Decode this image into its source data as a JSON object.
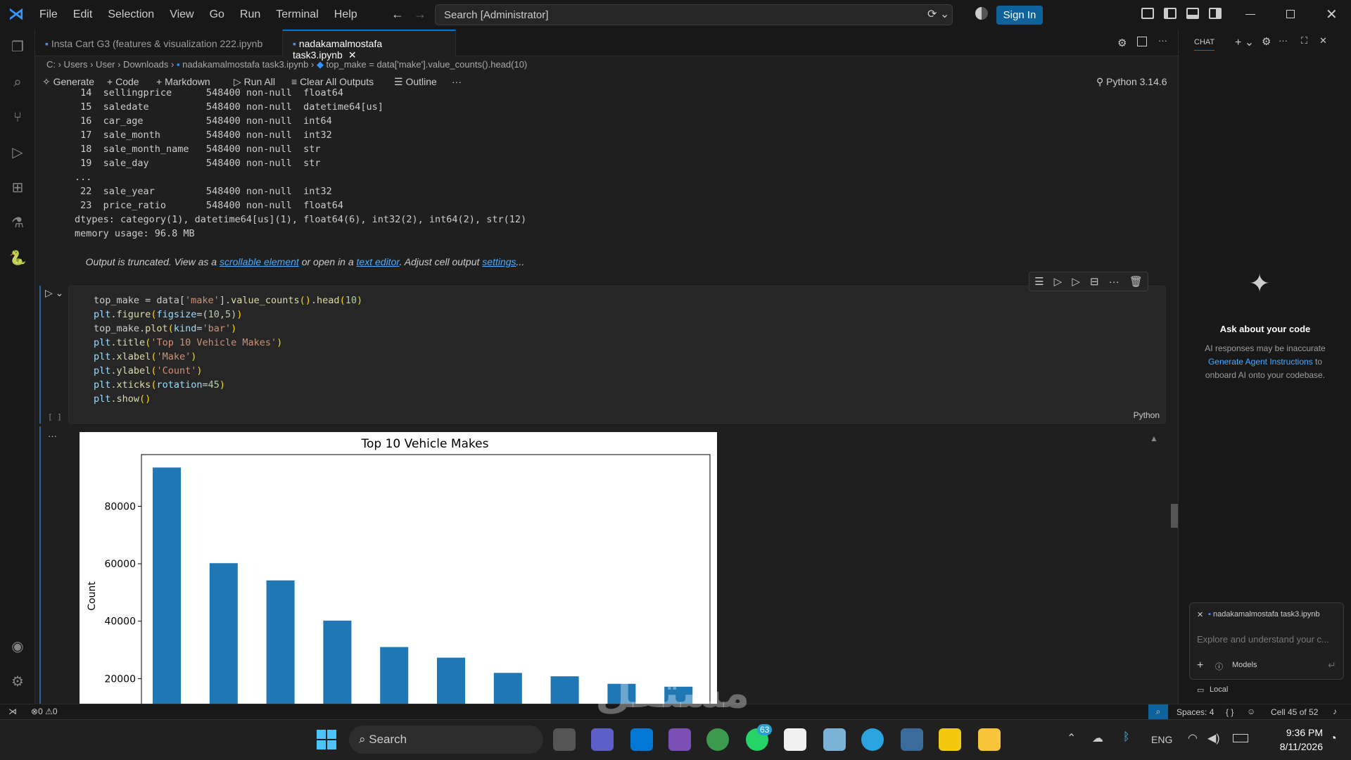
{
  "titlebar": {
    "menu": [
      "File",
      "Edit",
      "Selection",
      "View",
      "Go",
      "Run",
      "Terminal",
      "Help"
    ],
    "search_placeholder": "Search [Administrator]",
    "sign_in": "Sign In"
  },
  "tabs": [
    {
      "label": "Insta Cart G3 (features & visualization 222.ipynb"
    },
    {
      "label": "nadakamalmostafa task3.ipynb"
    }
  ],
  "breadcrumb": {
    "path": "C: › Users › User › Downloads › ",
    "file": "nadakamalmostafa task3.ipynb",
    "sep": " › ",
    "cell": "top_make = data['make'].value_counts().head(10)"
  },
  "toolbar": {
    "generate": "Generate",
    "code": "Code",
    "markdown": "Markdown",
    "run_all": "Run All",
    "clear": "Clear All Outputs",
    "outline": "Outline",
    "more": "···",
    "kernel": "Python 3.14.6"
  },
  "output": {
    "rows": [
      " 14  sellingprice      548400 non-null  float64",
      " 15  saledate          548400 non-null  datetime64[us]",
      " 16  car_age           548400 non-null  int64",
      " 17  sale_month        548400 non-null  int32",
      " 18  sale_month_name   548400 non-null  str",
      " 19  sale_day          548400 non-null  str",
      "...",
      " 22  sale_year         548400 non-null  int32",
      " 23  price_ratio       548400 non-null  float64",
      "dtypes: category(1), datetime64[us](1), float64(6), int32(2), int64(2), str(12)",
      "memory usage: 96.8 MB"
    ],
    "truncated_a": "Output is truncated. View as a ",
    "link_scroll": "scrollable element",
    "truncated_b": " or open in a ",
    "link_text": "text editor",
    "truncated_c": ". Adjust cell output ",
    "link_settings": "settings",
    "truncated_d": "..."
  },
  "cell": {
    "bracket": "[ ]",
    "lang": "Python",
    "ellipsis": "···"
  },
  "chart_data": {
    "type": "bar",
    "title": "Top 10 Vehicle Makes",
    "ylabel": "Count",
    "xlabel": "",
    "values": [
      93500,
      60200,
      54200,
      40200,
      31000,
      27300,
      22000,
      20800,
      18200,
      17200
    ],
    "ylim": [
      0,
      98000
    ],
    "yticks": [
      "20000",
      "40000",
      "60000",
      "80000"
    ],
    "bar_color": "#1f77b4"
  },
  "chat": {
    "header": "CHAT",
    "title": "Ask about your code",
    "desc_a": "AI responses may be inaccurate",
    "link": "Generate Agent Instructions",
    "desc_b": " to",
    "desc_c": "onboard AI onto your codebase.",
    "context_file": "nadakamalmostafa task3.ipynb",
    "input_placeholder": "Explore and understand your c...",
    "models": "Models",
    "local": "Local"
  },
  "status": {
    "errors": "0",
    "warnings": "0",
    "spaces": "Spaces: 4",
    "braces": "{ }",
    "cell_pos": "Cell 45 of 52"
  },
  "taskbar": {
    "search": "Search",
    "badge": "63",
    "lang": "ENG",
    "time": "9:36 PM",
    "date": "8/11/2026"
  },
  "watermark": "مستقل"
}
